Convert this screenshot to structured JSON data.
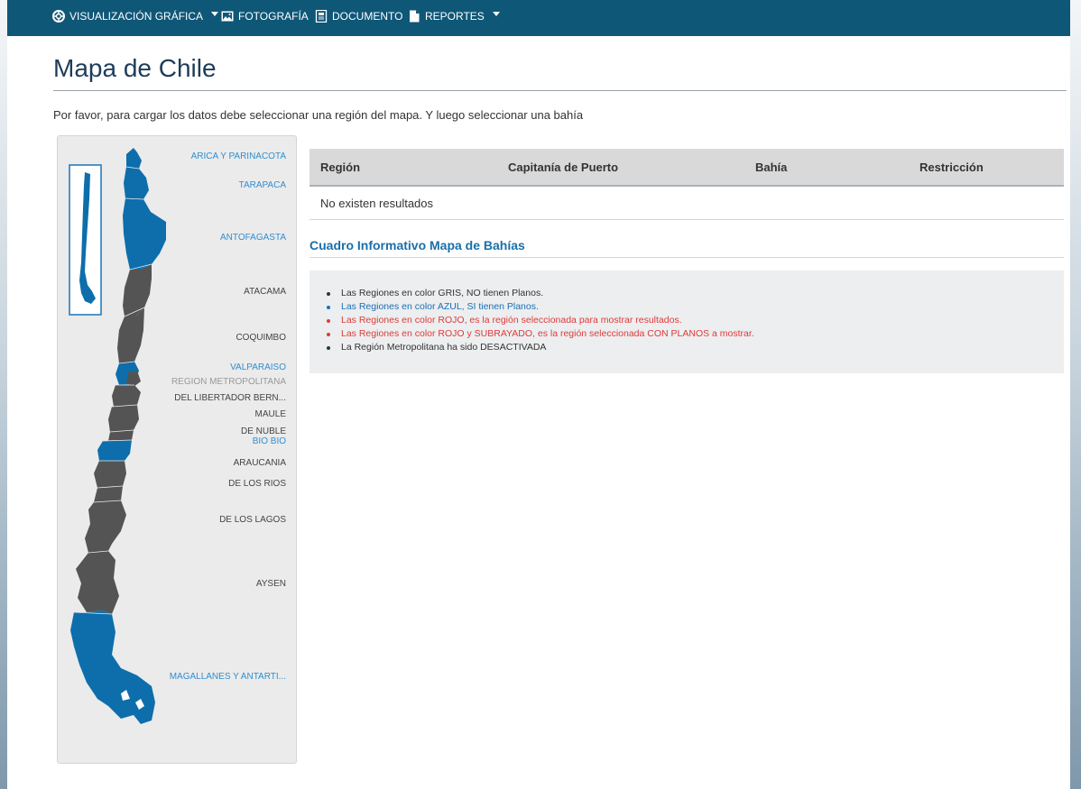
{
  "nav": {
    "items": [
      {
        "label": "VISUALIZACIÓN GRÁFICA",
        "icon": "lifebuoy-icon",
        "dropdown": true
      },
      {
        "label": "FOTOGRAFÍA",
        "icon": "image-icon",
        "dropdown": false
      },
      {
        "label": "DOCUMENTO",
        "icon": "document-icon",
        "dropdown": false
      },
      {
        "label": "REPORTES",
        "icon": "file-icon",
        "dropdown": true
      }
    ]
  },
  "page": {
    "title": "Mapa de Chile",
    "instructions": "Por favor, para cargar los datos debe seleccionar una región del mapa. Y luego seleccionar una bahía"
  },
  "map": {
    "regions": [
      {
        "label": "ARICA Y PARINACOTA",
        "status": "blue"
      },
      {
        "label": "TARAPACA",
        "status": "blue"
      },
      {
        "label": "ANTOFAGASTA",
        "status": "blue"
      },
      {
        "label": "ATACAMA",
        "status": "gray"
      },
      {
        "label": "COQUIMBO",
        "status": "gray"
      },
      {
        "label": "VALPARAISO",
        "status": "blue"
      },
      {
        "label": "REGION METROPOLITANA",
        "status": "disabled"
      },
      {
        "label": "DEL LIBERTADOR BERN...",
        "status": "gray"
      },
      {
        "label": "MAULE",
        "status": "gray"
      },
      {
        "label": "DE NUBLE",
        "status": "gray"
      },
      {
        "label": "BIO BIO",
        "status": "blue"
      },
      {
        "label": "ARAUCANIA",
        "status": "gray"
      },
      {
        "label": "DE LOS RIOS",
        "status": "gray"
      },
      {
        "label": "DE LOS LAGOS",
        "status": "gray"
      },
      {
        "label": "AYSEN",
        "status": "gray"
      },
      {
        "label": "MAGALLANES Y ANTARTI...",
        "status": "blue"
      }
    ],
    "colors": {
      "blue": "#0d6eab",
      "gray": "#545454",
      "label_blue": "#2e8fd0"
    }
  },
  "table": {
    "headers": [
      "Región",
      "Capitanía de Puerto",
      "Bahía",
      "Restricción"
    ],
    "empty_message": "No existen resultados"
  },
  "info": {
    "title": "Cuadro Informativo Mapa de Bahías",
    "items": [
      {
        "text": "Las Regiones en color GRIS, NO tienen Planos.",
        "color": "#333333"
      },
      {
        "text": "Las Regiones en color AZUL, SI tienen Planos.",
        "color": "#1a6fb8"
      },
      {
        "text": "Las Regiones en color ROJO, es la región seleccionada para mostrar resultados.",
        "color": "#e03a3a"
      },
      {
        "text": "Las Regiones en color ROJO y SUBRAYADO, es la región seleccionada CON PLANOS a mostrar.",
        "color": "#e03a3a"
      },
      {
        "text": "La Región Metropolitana ha sido DESACTIVADA",
        "color": "#333333"
      }
    ]
  }
}
